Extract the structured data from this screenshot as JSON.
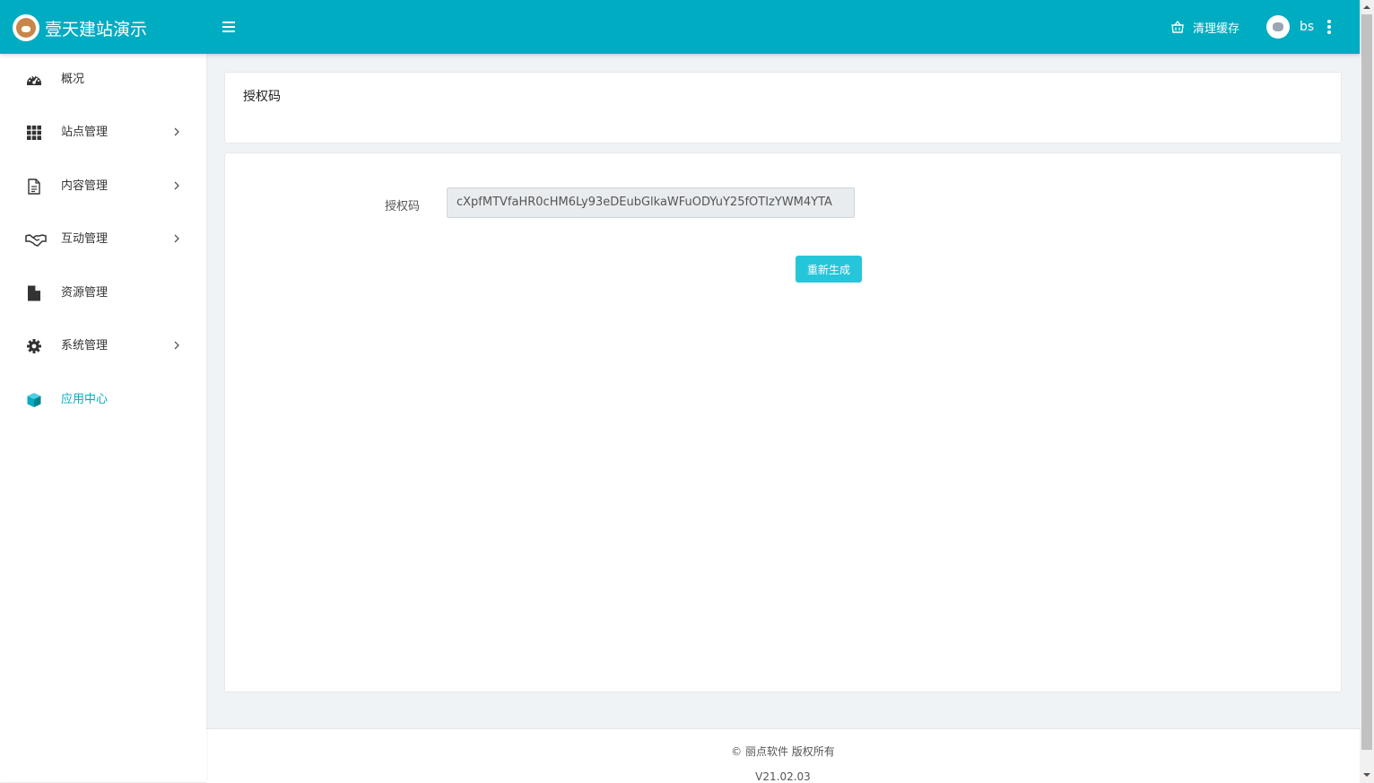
{
  "header": {
    "brand_title": "壹天建站演示",
    "clear_cache_label": "清理缓存",
    "username": "bs",
    "accent_color": "#00acc1"
  },
  "sidebar": {
    "items": [
      {
        "label": "概况",
        "icon": "dashboard-icon",
        "has_submenu": false
      },
      {
        "label": "站点管理",
        "icon": "grid-icon",
        "has_submenu": true
      },
      {
        "label": "内容管理",
        "icon": "document-icon",
        "has_submenu": true
      },
      {
        "label": "互动管理",
        "icon": "handshake-icon",
        "has_submenu": true
      },
      {
        "label": "资源管理",
        "icon": "file-icon",
        "has_submenu": false
      },
      {
        "label": "系统管理",
        "icon": "gear-icon",
        "has_submenu": true
      },
      {
        "label": "应用中心",
        "icon": "cube-icon",
        "has_submenu": false,
        "active": true
      }
    ]
  },
  "main": {
    "page_title": "授权码",
    "form": {
      "field_label": "授权码",
      "field_value": "cXpfMTVfaHR0cHM6Ly93eDEubGlkaWFuODYuY25fOTIzYWM4YTA",
      "regenerate_label": "重新生成"
    }
  },
  "footer": {
    "copyright": "© 丽点软件 版权所有",
    "version": "V21.02.03"
  }
}
